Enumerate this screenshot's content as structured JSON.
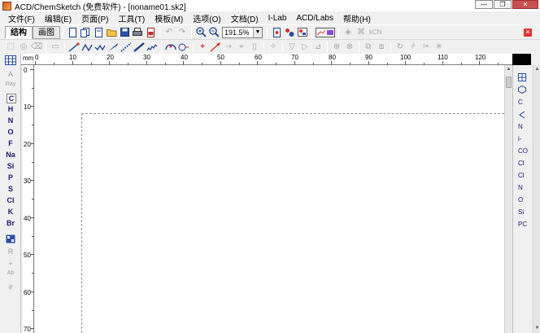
{
  "window": {
    "title": "ACD/ChemSketch (免费软件) - [noname01.sk2]",
    "min": "—",
    "max": "❐",
    "close": "✕"
  },
  "menu": [
    "文件(F)",
    "编辑(E)",
    "页面(P)",
    "工具(T)",
    "模板(M)",
    "选项(O)",
    "文档(D)",
    "I-Lab",
    "ACD/Labs",
    "帮助(H)"
  ],
  "toolbar1": {
    "tab_structure": "结构",
    "tab_draw": "画图",
    "zoom_value": "191.5%",
    "kcn_label": "kCN",
    "close_doc": "✕"
  },
  "ruler": {
    "unit": "mm",
    "h_marks": [
      "0",
      "10",
      "20",
      "30",
      "40",
      "50",
      "60",
      "70",
      "80",
      "90",
      "100",
      "110",
      "120"
    ],
    "v_marks": [
      "0",
      "10",
      "20",
      "30",
      "40",
      "50",
      "60",
      "70"
    ]
  },
  "elements": {
    "select": "A",
    "ray": "Ray",
    "list": [
      "C",
      "H",
      "N",
      "O",
      "F",
      "Na",
      "Si",
      "P",
      "S",
      "Cl",
      "K",
      "Br"
    ],
    "periodic": "",
    "r_group": "R",
    "charge": "+",
    "hash": "#"
  },
  "templates": [
    "",
    "",
    "C",
    "",
    "N",
    "i-",
    "CO",
    "Cl",
    "Cl",
    "N",
    "O",
    "Si",
    "PC"
  ]
}
